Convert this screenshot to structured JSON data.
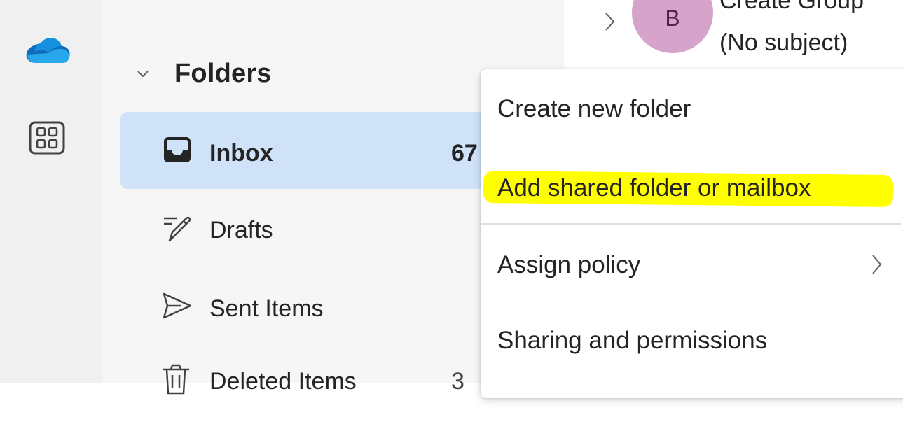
{
  "rail": {
    "icons": [
      "onedrive-icon",
      "apps-icon"
    ],
    "onedrive_color": "#0f6cbd"
  },
  "folders": {
    "title": "Folders",
    "items": [
      {
        "label": "Inbox",
        "count": "67",
        "icon": "inbox-icon",
        "selected": true
      },
      {
        "label": "Drafts",
        "count": "",
        "icon": "drafts-icon",
        "selected": false
      },
      {
        "label": "Sent Items",
        "count": "",
        "icon": "send-icon",
        "selected": false
      },
      {
        "label": "Deleted Items",
        "count": "3",
        "icon": "trash-icon",
        "selected": false
      }
    ]
  },
  "message": {
    "avatar_initial": "B",
    "sender": "Create Group",
    "subject": "(No subject)"
  },
  "context_menu": {
    "items": [
      {
        "label": "Create new folder"
      },
      {
        "label": "Add shared folder or mailbox",
        "highlighted": true
      },
      {
        "label": "Assign policy",
        "has_submenu": true
      },
      {
        "label": "Sharing and permissions"
      }
    ],
    "highlight_color": "#ffff00"
  },
  "colors": {
    "selected_bg": "#cfe2f8",
    "pane_bg": "#f6f6f6",
    "rail_bg": "#f0f0f0",
    "avatar_bg": "#d6a3cb"
  }
}
